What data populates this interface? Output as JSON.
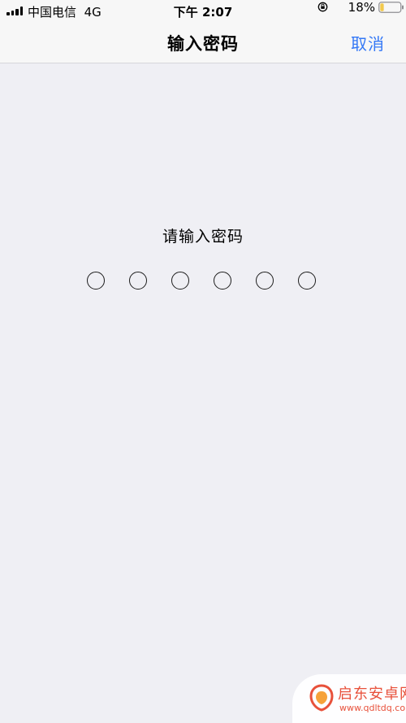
{
  "status_bar": {
    "carrier": "中国电信",
    "network": "4G",
    "time": "下午 2:07",
    "battery_percent": "18%",
    "battery_level": 0.18,
    "battery_color": "#f2c94c"
  },
  "nav_bar": {
    "title": "输入密码",
    "cancel_label": "取消",
    "accent_color": "#3478f6"
  },
  "passcode": {
    "prompt": "请输入密码",
    "length": 6,
    "entered": 0
  },
  "watermark": {
    "name": "启东安卓网",
    "url": "www.qdltdq.com",
    "color": "#e8513b"
  }
}
